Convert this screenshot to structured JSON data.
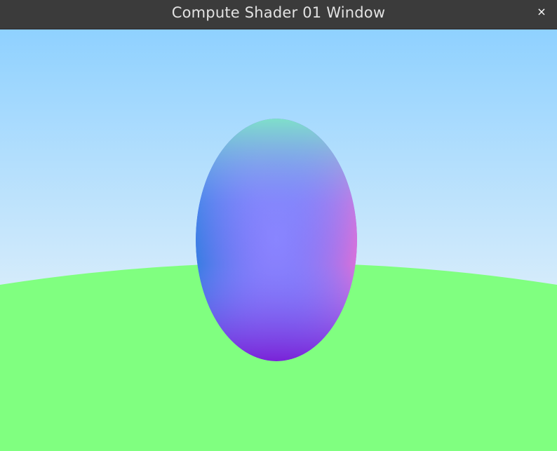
{
  "window": {
    "title": "Compute Shader 01 Window",
    "close_glyph": "×",
    "close_icon": "close-icon"
  },
  "scene": {
    "sky_color_top": "#8fd1ff",
    "sky_color_horizon": "#d6ecfb",
    "ground_color": "#80ff80",
    "sphere_colors": {
      "top": "#7fe5c8",
      "left": "#2f7fe0",
      "center": "#8080ff",
      "right": "#e070d8",
      "bottom": "#7a1fd6"
    }
  }
}
